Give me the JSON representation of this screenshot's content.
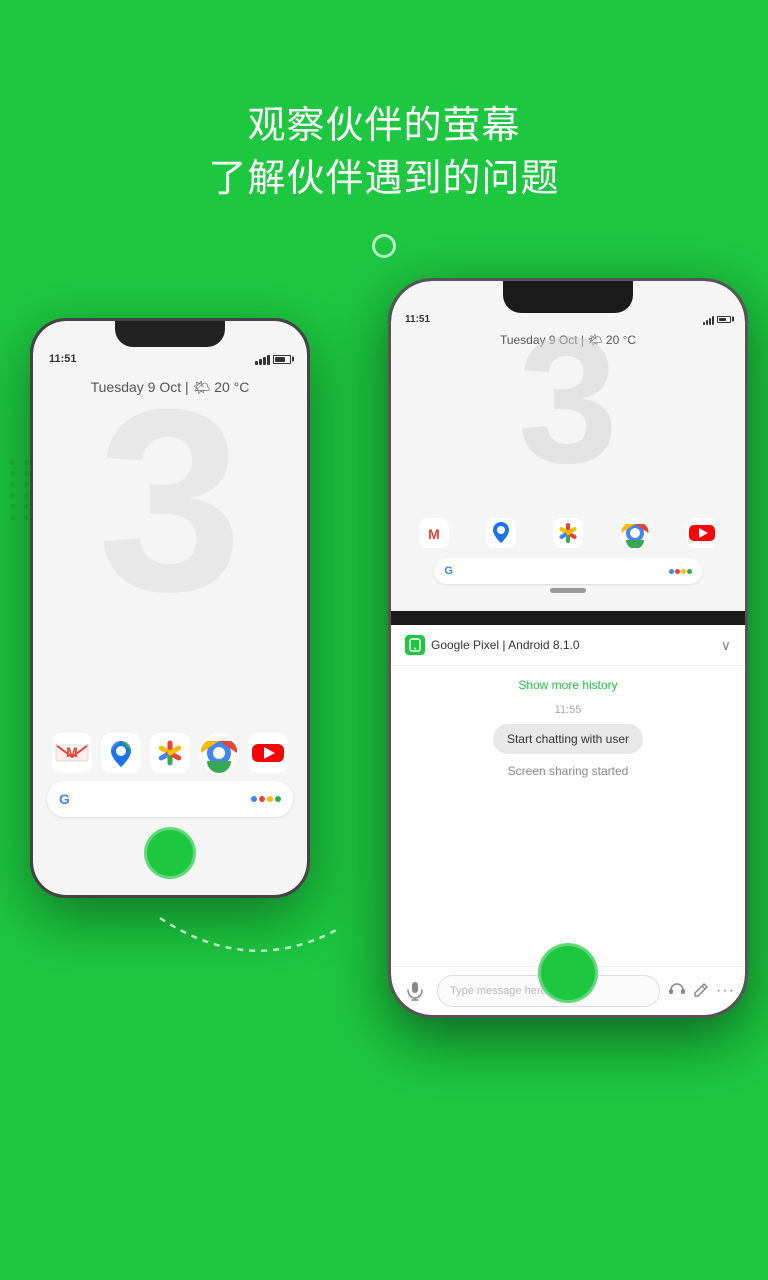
{
  "page": {
    "background_color": "#1dc740",
    "header": {
      "line1": "观察伙伴的萤幕",
      "line2": "了解伙伴遇到的问题"
    },
    "circle_indicator": true
  },
  "phone_left": {
    "time": "11:51",
    "date_weather": "Tuesday 9 Oct | 🌤 20 °C",
    "watermark": "3",
    "app_row1": [
      "M",
      "📍",
      "🎨",
      "🌐",
      "▶"
    ],
    "app_row2": [
      "G",
      "🎤"
    ]
  },
  "phone_right": {
    "device_label": "Google Pixel | Android 8.1.0",
    "inner_screen": {
      "time": "11:51",
      "date_weather": "Tuesday 9 Oct | 🌤 20 °C",
      "watermark": "3",
      "app_row": [
        "M",
        "📍",
        "🎨",
        "🌐",
        "▶"
      ],
      "google_row": [
        "G",
        "🎤"
      ]
    },
    "chat": {
      "show_history": "Show more history",
      "timestamp": "11:55",
      "bubble": "Start chatting with user",
      "screen_sharing": "Screen sharing started",
      "input_placeholder": "Type message here"
    }
  },
  "icons": {
    "chevron_down": "∨",
    "mic": "🎤",
    "headset": "🎧",
    "pencil": "✏",
    "more": "···"
  }
}
